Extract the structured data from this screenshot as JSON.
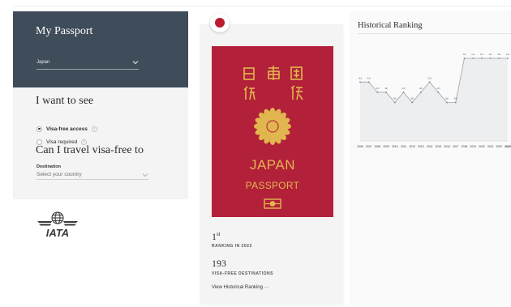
{
  "my_passport": {
    "title": "My Passport",
    "country": "Japan"
  },
  "want_to_see": {
    "title": "I want to see",
    "options": [
      {
        "label": "Visa-free access",
        "selected": true
      },
      {
        "label": "Visa required",
        "selected": false
      }
    ]
  },
  "travel": {
    "title": "Can I travel visa-free to",
    "destination_label": "Destination",
    "destination_placeholder": "Select your country"
  },
  "logo": {
    "text": "IATA"
  },
  "passport_card": {
    "flag_color": "#bc1a2f",
    "cover_color": "#b2203a",
    "emblem_color": "#e2b64e",
    "cover_country": "JAPAN",
    "cover_word": "PASSPORT",
    "ranking_number": "1",
    "ranking_suffix": "st",
    "ranking_label": "RANKING IN 2022",
    "destinations_number": "193",
    "destinations_label": "VISA-FREE DESTINATIONS",
    "history_link": "View Historical Ranking"
  },
  "historical": {
    "title": "Historical Ranking"
  },
  "chart_data": {
    "type": "line",
    "title": "",
    "x": [
      "2006",
      "2007",
      "2008",
      "2009",
      "2010",
      "2011",
      "2012",
      "2013",
      "2014",
      "2015",
      "2016",
      "2017",
      "2018",
      "2019",
      "2020",
      "2021",
      "2022",
      "2023"
    ],
    "series": [
      {
        "values": [
          3,
          3,
          4,
          4,
          5,
          4,
          5,
          4,
          3,
          4,
          5,
          5,
          1,
          1,
          1,
          1,
          1,
          1
        ]
      }
    ],
    "point_labels": [
      "3rd",
      "3rd",
      "4th",
      "4th",
      "5th",
      "4th",
      "5th",
      "4th",
      "3rd",
      "4th",
      "5th",
      "5th",
      "1st",
      "1st",
      "1st",
      "1st",
      "1st",
      "1st"
    ],
    "ylim": [
      1,
      5
    ],
    "y_inverted": true,
    "grid": false,
    "line_color": "#9aa4ae",
    "fill_color": "#eceef0"
  }
}
